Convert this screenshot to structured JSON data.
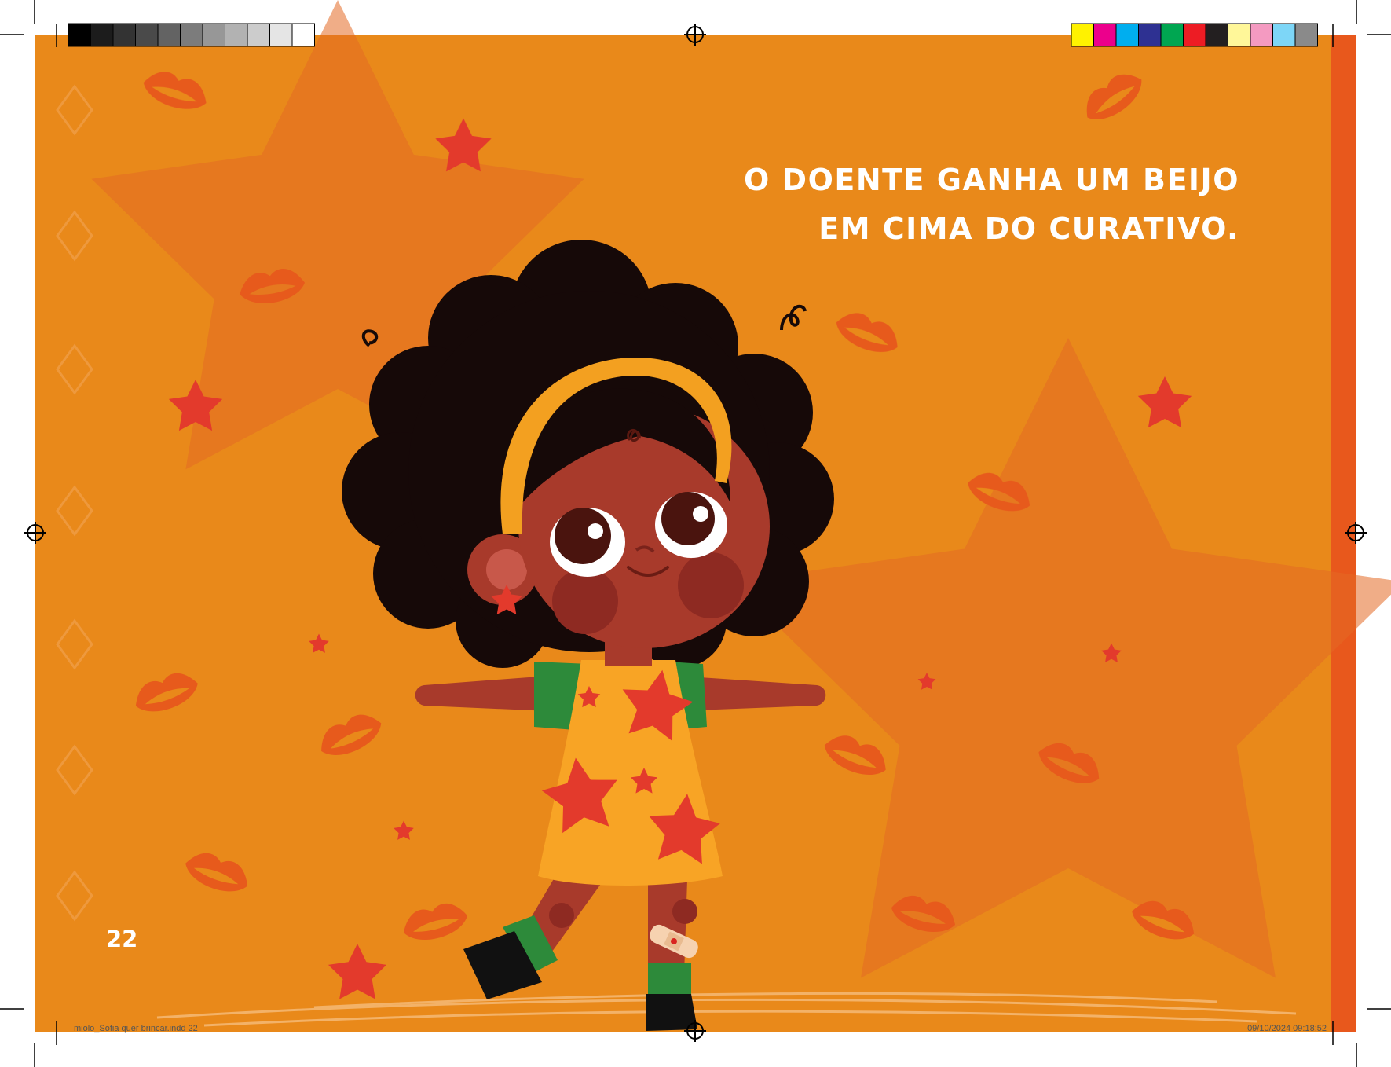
{
  "page": {
    "text_lines": [
      "O DOENTE GANHA UM BEIJO",
      "EM CIMA DO CURATIVO."
    ],
    "page_number": "22"
  },
  "print_marks": {
    "slug_file": "miolo_Sofia quer brincar.indd   22",
    "slug_timestamp": "09/10/2024   09:18:52",
    "grayscale_bar": [
      "#000000",
      "#1c1c1c",
      "#333333",
      "#4a4a4a",
      "#636363",
      "#7c7c7c",
      "#979797",
      "#b2b2b2",
      "#cccccc",
      "#e5e5e5",
      "#ffffff"
    ],
    "color_bar": [
      "#fff200",
      "#ec008c",
      "#00aeef",
      "#2e3192",
      "#00a651",
      "#ed1c24",
      "#231f20",
      "#fff799",
      "#f49ac1",
      "#7dd6f7",
      "#8a8a8a"
    ]
  },
  "illustration": {
    "subject": "girl-with-bandage",
    "background_color": "#e9891a",
    "big_star_color": "#e36a26",
    "lips_color": "#e75a1c",
    "star_color": "#e33a2c",
    "skin_color": "#a83a2b",
    "hair_color": "#160908",
    "headband_color": "#f3a020",
    "dress_color": "#f8a425",
    "sleeve_color": "#2d8a3a"
  }
}
